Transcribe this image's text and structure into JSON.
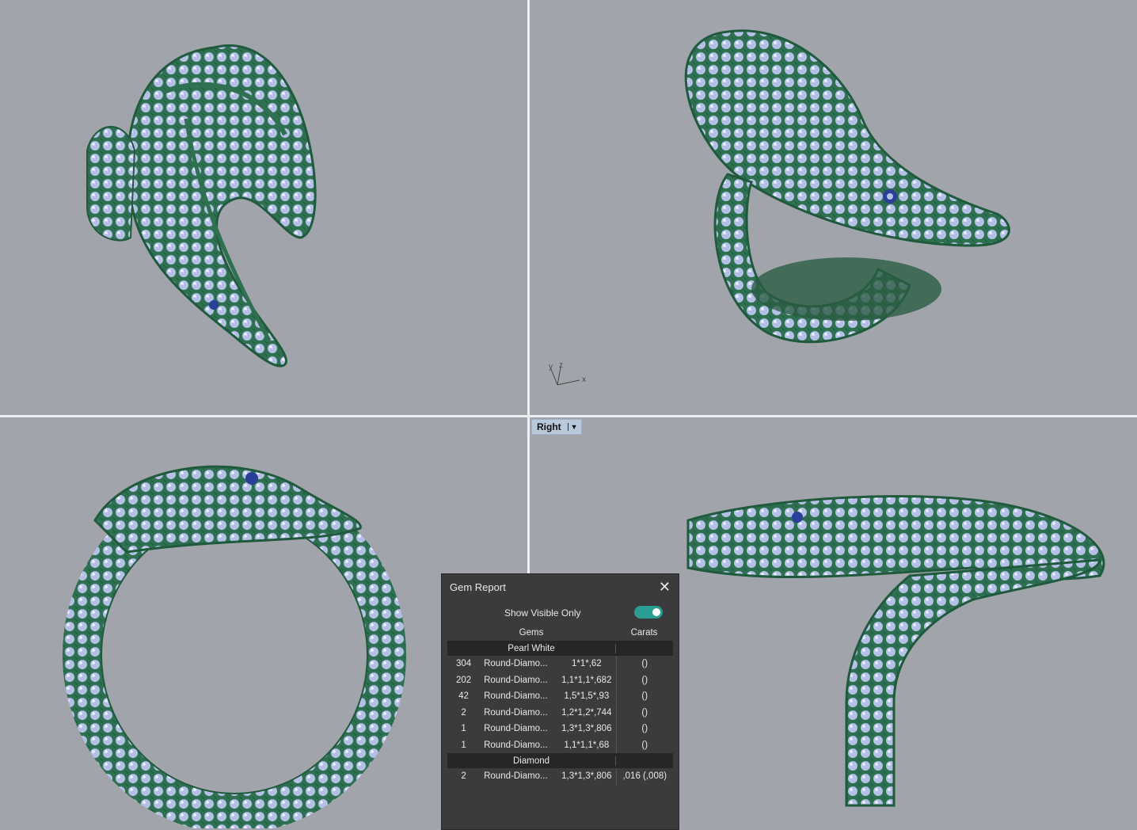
{
  "viewport_label": "Right",
  "axis": {
    "x": "x",
    "y": "y",
    "z": "z"
  },
  "gem_report": {
    "title": "Gem Report",
    "show_visible_only": "Show Visible Only",
    "toggle_on": true,
    "columns": {
      "gems": "Gems",
      "carats": "Carats"
    },
    "groups": [
      {
        "name": "Pearl White",
        "rows": [
          {
            "count": "304",
            "type": "Round-Diamo...",
            "size": "1*1*,62",
            "carats": "()"
          },
          {
            "count": "202",
            "type": "Round-Diamo...",
            "size": "1,1*1,1*,682",
            "carats": "()"
          },
          {
            "count": "42",
            "type": "Round-Diamo...",
            "size": "1,5*1,5*,93",
            "carats": "()"
          },
          {
            "count": "2",
            "type": "Round-Diamo...",
            "size": "1,2*1,2*,744",
            "carats": "()"
          },
          {
            "count": "1",
            "type": "Round-Diamo...",
            "size": "1,3*1,3*,806",
            "carats": "()"
          },
          {
            "count": "1",
            "type": "Round-Diamo...",
            "size": "1,1*1,1*,68",
            "carats": "()"
          }
        ]
      },
      {
        "name": "Diamond",
        "rows": [
          {
            "count": "2",
            "type": "Round-Diamo...",
            "size": "1,3*1,3*,806",
            "carats": ",016 (,008)"
          }
        ]
      }
    ]
  },
  "colors": {
    "metal": "#2f7050",
    "gem": "#b5c0e6",
    "eye": "#2a3f9a",
    "background": "#a1a5ab"
  }
}
